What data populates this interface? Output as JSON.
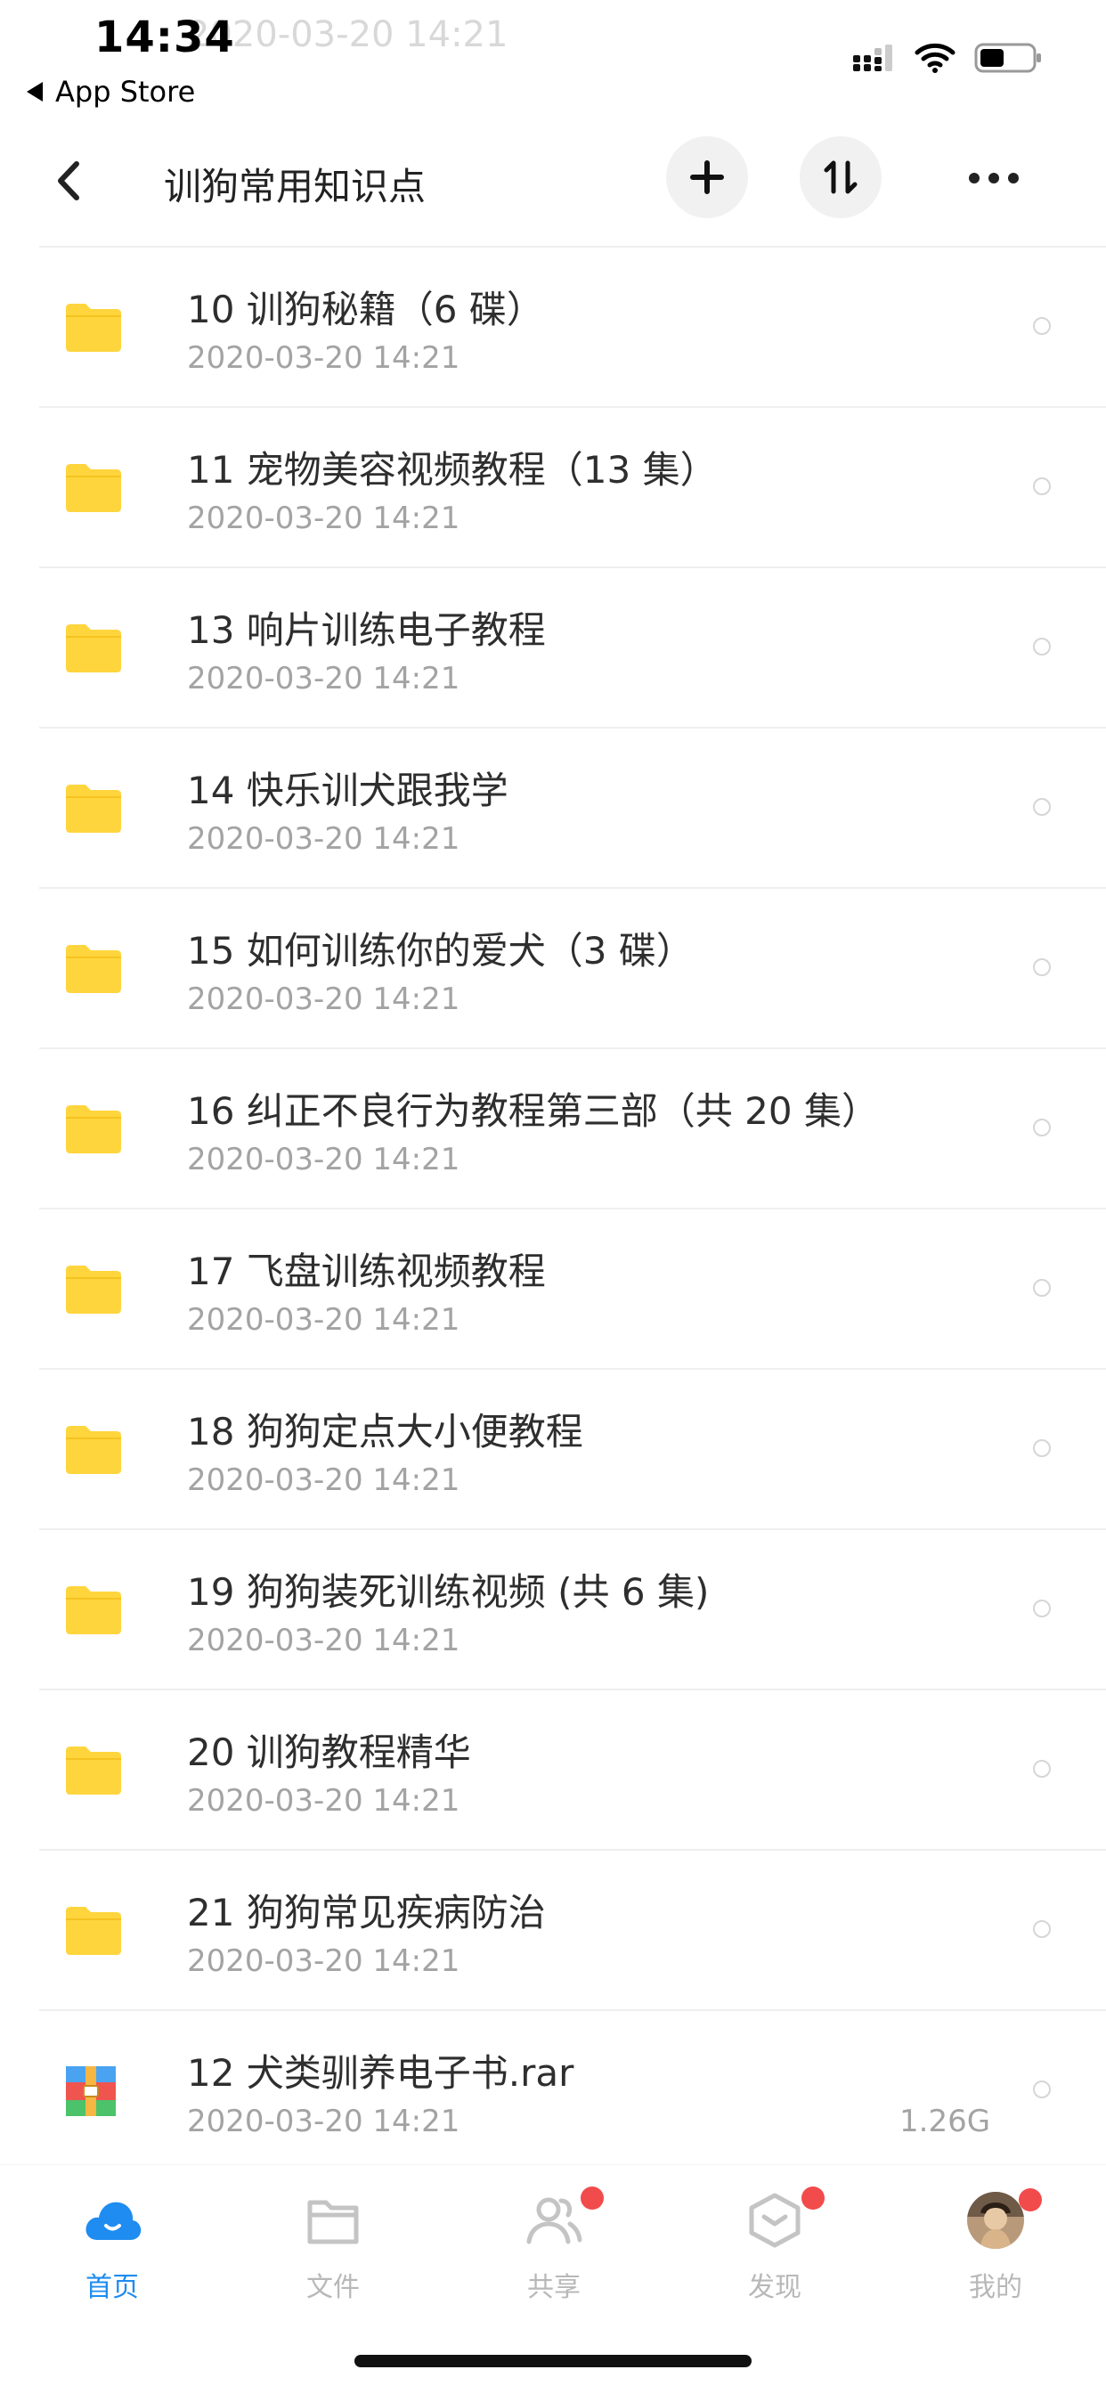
{
  "status_bar": {
    "time": "14:34",
    "back_app": "App Store",
    "ghost_date": "2020-03-20 14:21"
  },
  "header": {
    "title": "训狗常用知识点"
  },
  "files": [
    {
      "name": "10 训狗秘籍（6 碟）",
      "date": "2020-03-20 14:21",
      "type": "folder",
      "size": ""
    },
    {
      "name": "11 宠物美容视频教程（13 集）",
      "date": "2020-03-20 14:21",
      "type": "folder",
      "size": ""
    },
    {
      "name": "13 响片训练电子教程",
      "date": "2020-03-20 14:21",
      "type": "folder",
      "size": ""
    },
    {
      "name": "14 快乐训犬跟我学",
      "date": "2020-03-20 14:21",
      "type": "folder",
      "size": ""
    },
    {
      "name": "15 如何训练你的爱犬（3 碟）",
      "date": "2020-03-20 14:21",
      "type": "folder",
      "size": ""
    },
    {
      "name": "16 纠正不良行为教程第三部（共 20 集）",
      "date": "2020-03-20 14:21",
      "type": "folder",
      "size": ""
    },
    {
      "name": "17 飞盘训练视频教程",
      "date": "2020-03-20 14:21",
      "type": "folder",
      "size": ""
    },
    {
      "name": "18 狗狗定点大小便教程",
      "date": "2020-03-20 14:21",
      "type": "folder",
      "size": ""
    },
    {
      "name": "19 狗狗装死训练视频 (共 6 集)",
      "date": "2020-03-20 14:21",
      "type": "folder",
      "size": ""
    },
    {
      "name": "20 训狗教程精华",
      "date": "2020-03-20 14:21",
      "type": "folder",
      "size": ""
    },
    {
      "name": "21 狗狗常见疾病防治",
      "date": "2020-03-20 14:21",
      "type": "folder",
      "size": ""
    },
    {
      "name": "12 犬类驯养电子书.rar",
      "date": "2020-03-20 14:21",
      "type": "archive",
      "size": "1.26G"
    }
  ],
  "tabs": [
    {
      "label": "首页",
      "icon": "cloud-icon",
      "active": true,
      "badge": false
    },
    {
      "label": "文件",
      "icon": "folder-icon",
      "active": false,
      "badge": false
    },
    {
      "label": "共享",
      "icon": "people-icon",
      "active": false,
      "badge": true
    },
    {
      "label": "发现",
      "icon": "discover-icon",
      "active": false,
      "badge": true
    },
    {
      "label": "我的",
      "icon": "avatar-icon",
      "active": false,
      "badge": true
    }
  ],
  "colors": {
    "accent": "#1e8cf0",
    "folder": "#ffd53d",
    "badge": "#f24b4b",
    "muted": "#a3a3a3"
  }
}
